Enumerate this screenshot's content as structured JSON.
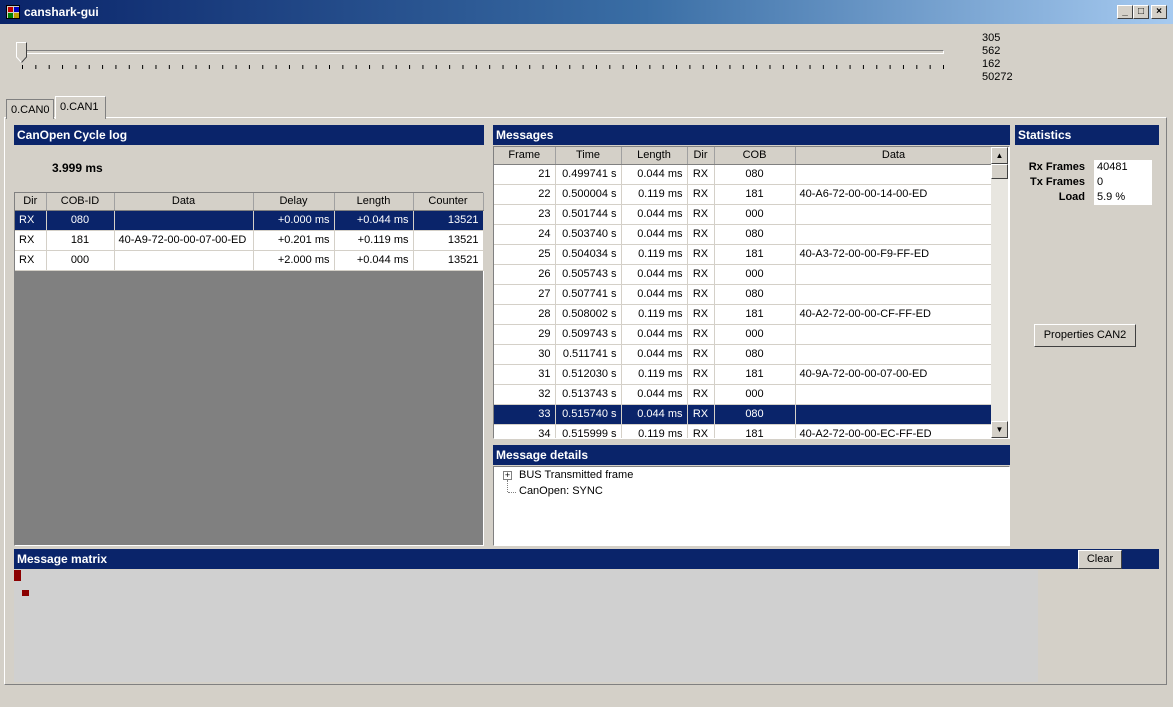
{
  "window": {
    "title": "canshark-gui"
  },
  "window_buttons": {
    "minimize": "_",
    "maximize": "□",
    "close": "×"
  },
  "slider": {
    "position_fraction": 0.0,
    "readouts": [
      "305",
      "562",
      "162",
      "50272"
    ]
  },
  "tabs": [
    {
      "label": "0.CAN0",
      "selected": false
    },
    {
      "label": "0.CAN1",
      "selected": true
    }
  ],
  "cycle_log": {
    "title": "CanOpen Cycle log",
    "cycle_time": "3.999 ms",
    "columns": [
      "Dir",
      "COB-ID",
      "Data",
      "Delay",
      "Length",
      "Counter"
    ],
    "rows": [
      {
        "dir": "RX",
        "cob_id": "080",
        "data": "",
        "delay": "+0.000 ms",
        "length": "+0.044 ms",
        "counter": "13521",
        "selected": true
      },
      {
        "dir": "RX",
        "cob_id": "181",
        "data": "40-A9-72-00-00-07-00-ED",
        "delay": "+0.201 ms",
        "length": "+0.119 ms",
        "counter": "13521",
        "selected": false
      },
      {
        "dir": "RX",
        "cob_id": "000",
        "data": "",
        "delay": "+2.000 ms",
        "length": "+0.044 ms",
        "counter": "13521",
        "selected": false
      }
    ]
  },
  "messages": {
    "title": "Messages",
    "columns": [
      "Frame",
      "Time",
      "Length",
      "Dir",
      "COB",
      "Data"
    ],
    "rows": [
      {
        "frame": "21",
        "time": "0.499741 s",
        "length": "0.044 ms",
        "dir": "RX",
        "cob": "080",
        "data": "",
        "selected": false
      },
      {
        "frame": "22",
        "time": "0.500004 s",
        "length": "0.119 ms",
        "dir": "RX",
        "cob": "181",
        "data": "40-A6-72-00-00-14-00-ED",
        "selected": false
      },
      {
        "frame": "23",
        "time": "0.501744 s",
        "length": "0.044 ms",
        "dir": "RX",
        "cob": "000",
        "data": "",
        "selected": false
      },
      {
        "frame": "24",
        "time": "0.503740 s",
        "length": "0.044 ms",
        "dir": "RX",
        "cob": "080",
        "data": "",
        "selected": false
      },
      {
        "frame": "25",
        "time": "0.504034 s",
        "length": "0.119 ms",
        "dir": "RX",
        "cob": "181",
        "data": "40-A3-72-00-00-F9-FF-ED",
        "selected": false
      },
      {
        "frame": "26",
        "time": "0.505743 s",
        "length": "0.044 ms",
        "dir": "RX",
        "cob": "000",
        "data": "",
        "selected": false
      },
      {
        "frame": "27",
        "time": "0.507741 s",
        "length": "0.044 ms",
        "dir": "RX",
        "cob": "080",
        "data": "",
        "selected": false
      },
      {
        "frame": "28",
        "time": "0.508002 s",
        "length": "0.119 ms",
        "dir": "RX",
        "cob": "181",
        "data": "40-A2-72-00-00-CF-FF-ED",
        "selected": false
      },
      {
        "frame": "29",
        "time": "0.509743 s",
        "length": "0.044 ms",
        "dir": "RX",
        "cob": "000",
        "data": "",
        "selected": false
      },
      {
        "frame": "30",
        "time": "0.511741 s",
        "length": "0.044 ms",
        "dir": "RX",
        "cob": "080",
        "data": "",
        "selected": false
      },
      {
        "frame": "31",
        "time": "0.512030 s",
        "length": "0.119 ms",
        "dir": "RX",
        "cob": "181",
        "data": "40-9A-72-00-00-07-00-ED",
        "selected": false
      },
      {
        "frame": "32",
        "time": "0.513743 s",
        "length": "0.044 ms",
        "dir": "RX",
        "cob": "000",
        "data": "",
        "selected": false
      },
      {
        "frame": "33",
        "time": "0.515740 s",
        "length": "0.044 ms",
        "dir": "RX",
        "cob": "080",
        "data": "",
        "selected": true
      },
      {
        "frame": "34",
        "time": "0.515999 s",
        "length": "0.119 ms",
        "dir": "RX",
        "cob": "181",
        "data": "40-A2-72-00-00-EC-FF-ED",
        "selected": false
      }
    ]
  },
  "message_details": {
    "title": "Message details",
    "tree": [
      {
        "expander": "+",
        "label": "BUS Transmitted frame"
      },
      {
        "expander": "",
        "label": "CanOpen: SYNC"
      }
    ]
  },
  "statistics": {
    "title": "Statistics",
    "rx_frames_label": "Rx Frames",
    "rx_frames": "40481",
    "tx_frames_label": "Tx Frames",
    "tx_frames": "0",
    "load_label": "Load",
    "load": "5.9 %",
    "properties_button": "Properties CAN2"
  },
  "matrix": {
    "title": "Message matrix",
    "clear_button": "Clear",
    "marker_color": "#8b0000"
  },
  "colors": {
    "title_bar": "#0a246a",
    "selection": "#0a246a",
    "face": "#d4d0c8"
  }
}
